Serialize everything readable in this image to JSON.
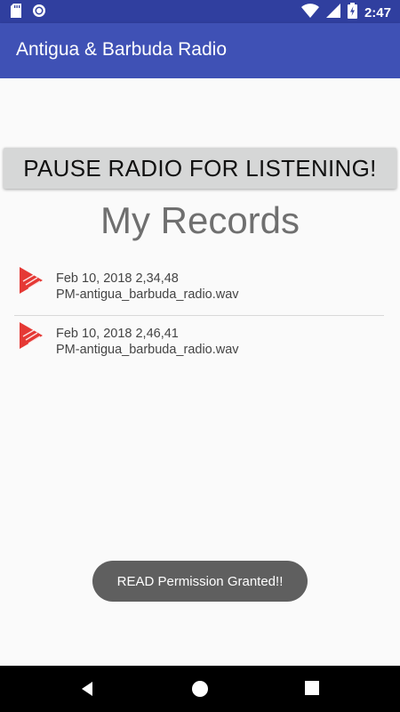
{
  "status_bar": {
    "time": "2:47",
    "icons": [
      "sd-card-icon",
      "sync-icon",
      "wifi-icon",
      "signal-icon",
      "battery-charging-icon"
    ]
  },
  "app_bar": {
    "title": "Antigua & Barbuda Radio"
  },
  "main": {
    "pause_button_label": "PAUSE RADIO FOR LISTENING!",
    "records_title": "My Records",
    "records": [
      {
        "line1": "Feb 10, 2018 2,34,48",
        "line2": "PM-antigua_barbuda_radio.wav"
      },
      {
        "line1": "Feb 10, 2018 2,46,41",
        "line2": "PM-antigua_barbuda_radio.wav"
      }
    ]
  },
  "toast": {
    "message": "READ Permission Granted!!"
  },
  "colors": {
    "primary": "#3f51b5",
    "primary_dark": "#303f9f",
    "play_icon": "#e53935"
  }
}
